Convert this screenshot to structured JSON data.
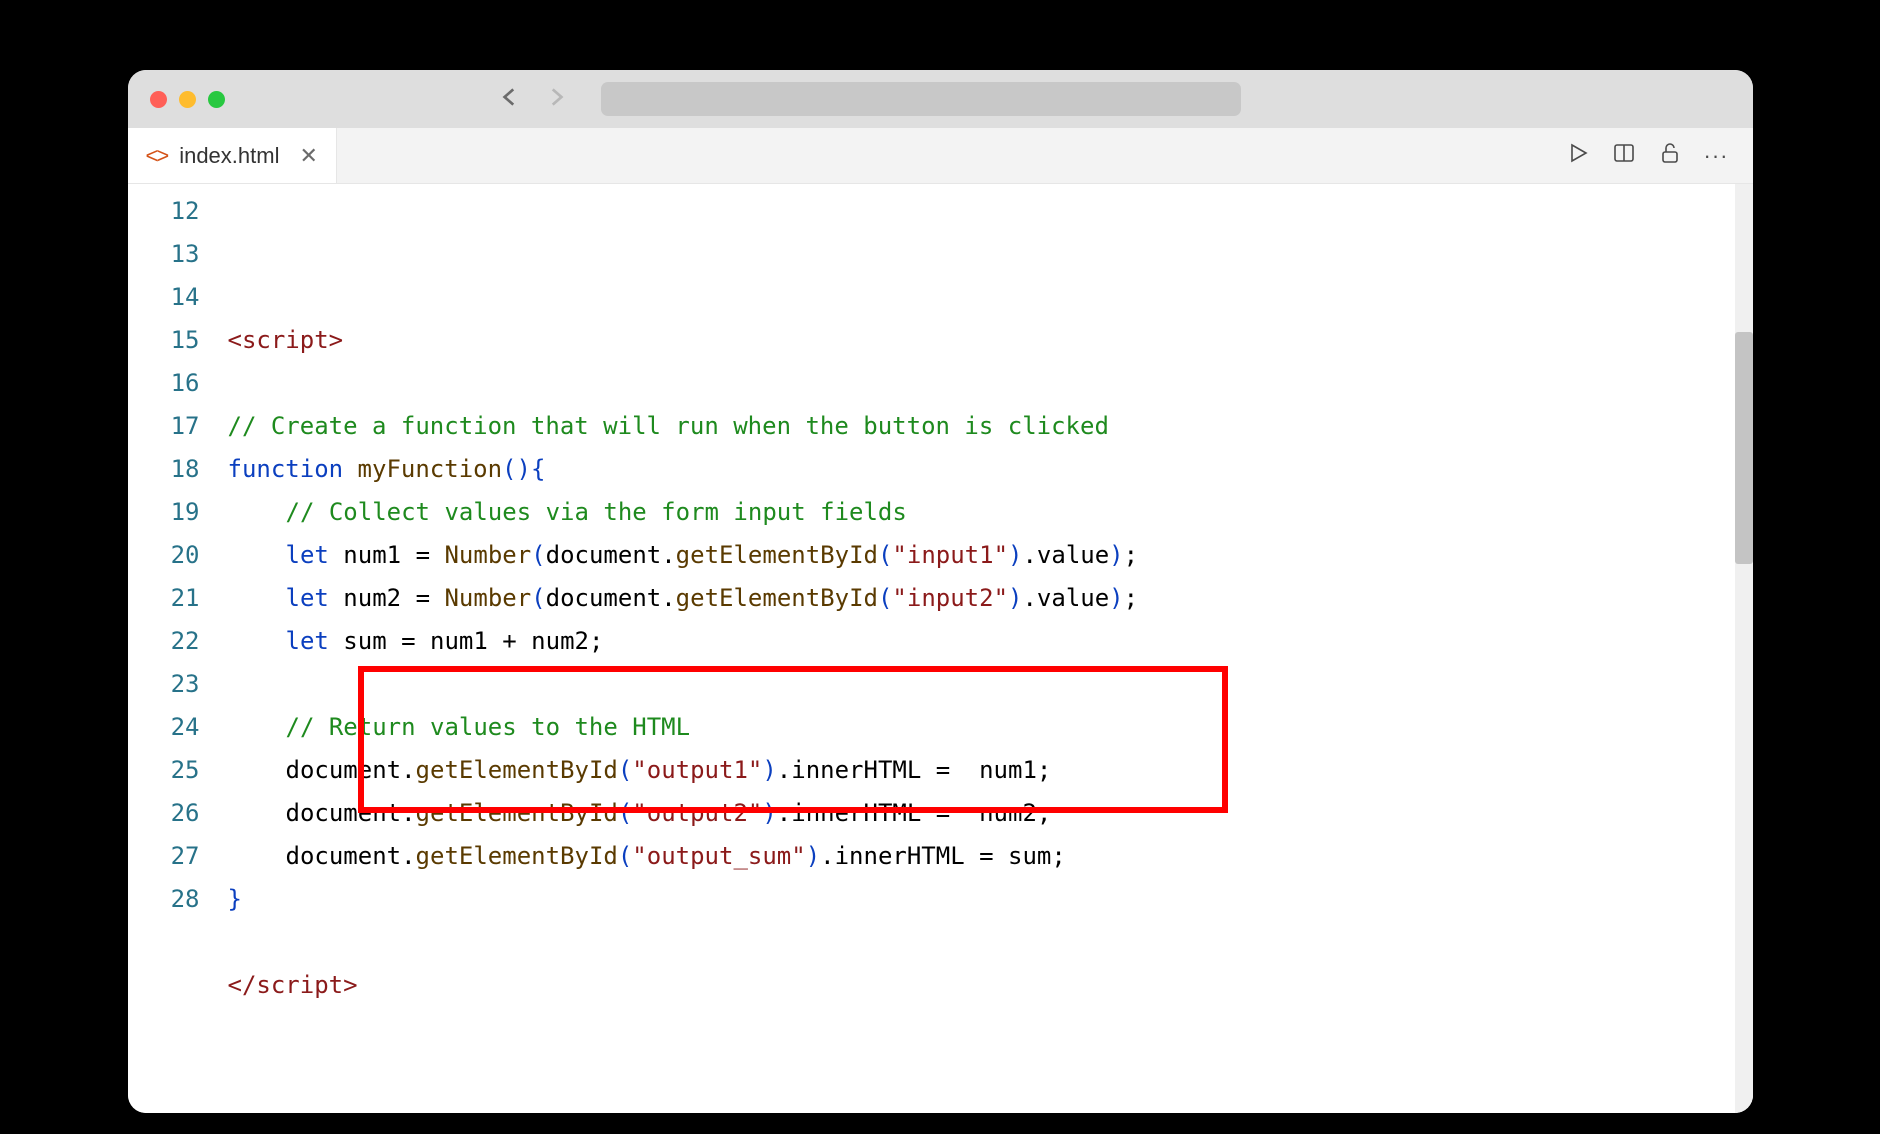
{
  "tab": {
    "label": "index.html",
    "icon": "<>"
  },
  "lines": [
    {
      "n": "12",
      "indent": 0,
      "tokens": []
    },
    {
      "n": "13",
      "indent": 0,
      "tokens": [
        {
          "t": "<script>",
          "c": "tok-tag"
        }
      ]
    },
    {
      "n": "14",
      "indent": 0,
      "tokens": []
    },
    {
      "n": "15",
      "indent": 0,
      "tokens": [
        {
          "t": "// Create a function that will run when the button is clicked",
          "c": "tok-comment"
        }
      ]
    },
    {
      "n": "16",
      "indent": 0,
      "tokens": [
        {
          "t": "function",
          "c": "tok-kw"
        },
        {
          "t": " ",
          "c": ""
        },
        {
          "t": "myFunction",
          "c": "tok-fn"
        },
        {
          "t": "()",
          "c": "tok-paren"
        },
        {
          "t": "{",
          "c": "tok-brace"
        }
      ]
    },
    {
      "n": "17",
      "indent": 1,
      "tokens": [
        {
          "t": "// Collect values via the form input fields",
          "c": "tok-comment"
        }
      ]
    },
    {
      "n": "18",
      "indent": 1,
      "tokens": [
        {
          "t": "let",
          "c": "tok-kw"
        },
        {
          "t": " num1 ",
          "c": "tok-var"
        },
        {
          "t": "=",
          "c": "tok-op"
        },
        {
          "t": " ",
          "c": ""
        },
        {
          "t": "Number",
          "c": "tok-fn"
        },
        {
          "t": "(",
          "c": "tok-paren"
        },
        {
          "t": "document",
          "c": "tok-var"
        },
        {
          "t": ".",
          "c": "tok-op"
        },
        {
          "t": "getElementById",
          "c": "tok-fn"
        },
        {
          "t": "(",
          "c": "tok-paren"
        },
        {
          "t": "\"input1\"",
          "c": "tok-str"
        },
        {
          "t": ")",
          "c": "tok-paren"
        },
        {
          "t": ".",
          "c": "tok-op"
        },
        {
          "t": "value",
          "c": "tok-var"
        },
        {
          "t": ")",
          "c": "tok-paren"
        },
        {
          "t": ";",
          "c": "tok-op"
        }
      ]
    },
    {
      "n": "19",
      "indent": 1,
      "tokens": [
        {
          "t": "let",
          "c": "tok-kw"
        },
        {
          "t": " num2 ",
          "c": "tok-var"
        },
        {
          "t": "=",
          "c": "tok-op"
        },
        {
          "t": " ",
          "c": ""
        },
        {
          "t": "Number",
          "c": "tok-fn"
        },
        {
          "t": "(",
          "c": "tok-paren"
        },
        {
          "t": "document",
          "c": "tok-var"
        },
        {
          "t": ".",
          "c": "tok-op"
        },
        {
          "t": "getElementById",
          "c": "tok-fn"
        },
        {
          "t": "(",
          "c": "tok-paren"
        },
        {
          "t": "\"input2\"",
          "c": "tok-str"
        },
        {
          "t": ")",
          "c": "tok-paren"
        },
        {
          "t": ".",
          "c": "tok-op"
        },
        {
          "t": "value",
          "c": "tok-var"
        },
        {
          "t": ")",
          "c": "tok-paren"
        },
        {
          "t": ";",
          "c": "tok-op"
        }
      ]
    },
    {
      "n": "20",
      "indent": 1,
      "tokens": [
        {
          "t": "let",
          "c": "tok-kw"
        },
        {
          "t": " sum ",
          "c": "tok-var"
        },
        {
          "t": "=",
          "c": "tok-op"
        },
        {
          "t": " num1 ",
          "c": "tok-var"
        },
        {
          "t": "+",
          "c": "tok-op"
        },
        {
          "t": " num2",
          "c": "tok-var"
        },
        {
          "t": ";",
          "c": "tok-op"
        }
      ]
    },
    {
      "n": "21",
      "indent": 0,
      "tokens": []
    },
    {
      "n": "22",
      "indent": 1,
      "tokens": [
        {
          "t": "// Return values to the HTML",
          "c": "tok-comment"
        }
      ]
    },
    {
      "n": "23",
      "indent": 1,
      "tokens": [
        {
          "t": "document",
          "c": "tok-var"
        },
        {
          "t": ".",
          "c": "tok-op"
        },
        {
          "t": "getElementById",
          "c": "tok-fn"
        },
        {
          "t": "(",
          "c": "tok-paren"
        },
        {
          "t": "\"output1\"",
          "c": "tok-str"
        },
        {
          "t": ")",
          "c": "tok-paren"
        },
        {
          "t": ".",
          "c": "tok-op"
        },
        {
          "t": "innerHTML",
          "c": "tok-var"
        },
        {
          "t": " =  ",
          "c": "tok-op"
        },
        {
          "t": "num1",
          "c": "tok-var"
        },
        {
          "t": ";",
          "c": "tok-op"
        }
      ]
    },
    {
      "n": "24",
      "indent": 1,
      "tokens": [
        {
          "t": "document",
          "c": "tok-var"
        },
        {
          "t": ".",
          "c": "tok-op"
        },
        {
          "t": "getElementById",
          "c": "tok-fn"
        },
        {
          "t": "(",
          "c": "tok-paren"
        },
        {
          "t": "\"output2\"",
          "c": "tok-str"
        },
        {
          "t": ")",
          "c": "tok-paren"
        },
        {
          "t": ".",
          "c": "tok-op"
        },
        {
          "t": "innerHTML",
          "c": "tok-var"
        },
        {
          "t": " =  ",
          "c": "tok-op"
        },
        {
          "t": "num2",
          "c": "tok-var"
        },
        {
          "t": ";",
          "c": "tok-op"
        }
      ]
    },
    {
      "n": "25",
      "indent": 1,
      "tokens": [
        {
          "t": "document",
          "c": "tok-var"
        },
        {
          "t": ".",
          "c": "tok-op"
        },
        {
          "t": "getElementById",
          "c": "tok-fn"
        },
        {
          "t": "(",
          "c": "tok-paren"
        },
        {
          "t": "\"output_sum\"",
          "c": "tok-str"
        },
        {
          "t": ")",
          "c": "tok-paren"
        },
        {
          "t": ".",
          "c": "tok-op"
        },
        {
          "t": "innerHTML",
          "c": "tok-var"
        },
        {
          "t": " = ",
          "c": "tok-op"
        },
        {
          "t": "sum",
          "c": "tok-var"
        },
        {
          "t": ";",
          "c": "tok-op"
        }
      ]
    },
    {
      "n": "26",
      "indent": 0,
      "tokens": [
        {
          "t": "}",
          "c": "tok-brace"
        }
      ]
    },
    {
      "n": "27",
      "indent": 0,
      "tokens": []
    },
    {
      "n": "28",
      "indent": 0,
      "tokens": [
        {
          "t": "</script>",
          "c": "tok-tag"
        }
      ]
    }
  ]
}
